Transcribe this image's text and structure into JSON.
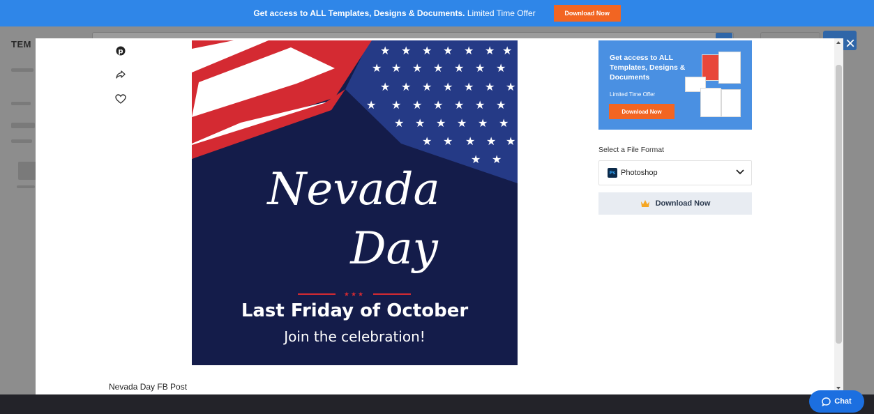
{
  "promo": {
    "text_bold": "Get access to ALL Templates, Designs & Documents.",
    "text_rest": " Limited Time Offer",
    "button": "Download Now"
  },
  "background": {
    "brand": "TEM"
  },
  "modal": {
    "close_icon": "×",
    "poster": {
      "script_word1": "Nevada",
      "script_word2": "Day",
      "line1": "Last Friday of October",
      "line2": "Join the celebration!",
      "divider_stars": "★★★"
    },
    "caption": "Nevada Day FB Post",
    "ad": {
      "title": "Get access to ALL Templates, Designs & Documents",
      "subtitle": "Limited Time Offer",
      "button": "Download Now"
    },
    "format": {
      "label": "Select a File Format",
      "selected": "Photoshop",
      "icon_text": "Ps"
    },
    "download_button": "Download Now"
  },
  "chat": {
    "label": "Chat"
  },
  "colors": {
    "promo_blue": "#2f86e8",
    "orange": "#f26522",
    "poster_navy": "#141c4a",
    "flag_red": "#d42a32",
    "chat_blue": "#1c6fe0"
  }
}
